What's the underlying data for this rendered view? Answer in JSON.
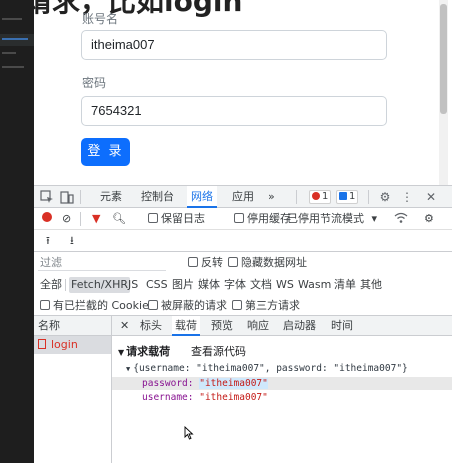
{
  "page": {
    "heading": "请求，比如login",
    "username_label": "账号名",
    "username_value": "itheima007",
    "password_label": "密码",
    "password_value": "7654321",
    "login_button": "登 录"
  },
  "devtools": {
    "tabs": [
      "元素",
      "控制台",
      "网络",
      "应用",
      "»"
    ],
    "active_tab": "网络",
    "error_count": "1",
    "message_count": "1",
    "toolbar": {
      "preserve_log": "保留日志",
      "disable_cache": "停用缓存",
      "throttling": "已停用节流模式"
    },
    "filter": {
      "placeholder": "过滤",
      "invert": "反转",
      "hide_data_urls": "隐藏数据网址"
    },
    "types": [
      "全部",
      "Fetch/XHR",
      "JS",
      "CSS",
      "图片",
      "媒体",
      "字体",
      "文档",
      "WS",
      "Wasm",
      "清单",
      "其他"
    ],
    "active_type": "Fetch/XHR",
    "blocked": {
      "blocked_cookies": "有已拦截的 Cookie",
      "blocked_requests": "被屏蔽的请求",
      "third_party": "第三方请求"
    },
    "request_list": {
      "header": "名称",
      "items": [
        "login"
      ]
    },
    "detail_tabs": [
      "标头",
      "载荷",
      "预览",
      "响应",
      "启动器",
      "时间"
    ],
    "active_detail_tab": "载荷",
    "payload": {
      "section_title": "请求载荷",
      "view_source": "查看源代码",
      "summary": "{username: \"itheima007\", password: \"itheima007\"}",
      "fields": [
        {
          "key": "password",
          "value": "\"itheima007\""
        },
        {
          "key": "username",
          "value": "\"itheima007\""
        }
      ]
    }
  }
}
